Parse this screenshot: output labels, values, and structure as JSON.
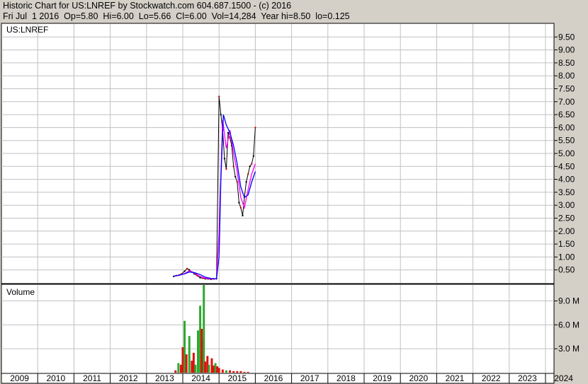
{
  "header": {
    "line1": "Historic Chart for US:LNREF by Stockwatch.com 604.687.1500 - (c) 2016",
    "line2": "Fri Jul  1 2016  Op=5.80  Hi=6.00  Lo=5.66  Cl=6.00  Vol=14,284  Year hi=8.50  lo=0.125"
  },
  "colors": {
    "background": "#d4d0c8",
    "panel": "#ffffff",
    "grid": "#c0c0c0",
    "up_bar": "#000000",
    "down_bar": "#cc0000",
    "ma_short": "#ff00ff",
    "ma_long": "#0000ff",
    "vol_up": "#2fa82f",
    "vol_down": "#e01010"
  },
  "chart_data": [
    {
      "type": "line",
      "title": "US:LNREF",
      "ylim": [
        0,
        10
      ],
      "yticks": [
        "0.50",
        "1.00",
        "1.50",
        "2.00",
        "2.50",
        "3.00",
        "3.50",
        "4.00",
        "4.50",
        "5.00",
        "5.50",
        "6.00",
        "6.50",
        "7.00",
        "7.50",
        "8.00",
        "8.50",
        "9.00",
        "9.50"
      ],
      "x_tick_labels": [
        "2009",
        "2010",
        "2011",
        "2012",
        "2013",
        "2014",
        "2015",
        "2016",
        "2017",
        "2018",
        "2019",
        "2020",
        "2021",
        "2022",
        "2023",
        "2024"
      ],
      "series": [
        {
          "name": "",
          "x": [
            2013.75,
            2013.82,
            2013.9,
            2013.97,
            2014.05,
            2014.12,
            2014.18,
            2014.25,
            2014.32,
            2014.4,
            2014.48,
            2014.55,
            2014.62,
            2014.7,
            2014.78,
            2014.86,
            2014.93,
            2015.0,
            2015.05,
            2015.1,
            2015.15,
            2015.2,
            2015.25,
            2015.3,
            2015.35,
            2015.4,
            2015.45,
            2015.5,
            2015.55,
            2015.6,
            2015.65,
            2015.7,
            2015.75,
            2015.8,
            2015.85,
            2015.9,
            2015.95,
            2016.0
          ],
          "y": [
            0.25,
            0.28,
            0.3,
            0.35,
            0.45,
            0.55,
            0.5,
            0.42,
            0.35,
            0.28,
            0.2,
            0.18,
            0.16,
            0.15,
            0.14,
            0.15,
            0.16,
            7.2,
            6.5,
            5.9,
            4.8,
            4.4,
            5.8,
            5.6,
            5.3,
            4.5,
            4.1,
            3.9,
            3.1,
            2.9,
            2.6,
            3.3,
            3.9,
            4.2,
            4.5,
            4.6,
            4.9,
            6.0
          ]
        },
        {
          "name": "",
          "x": [
            2013.75,
            2013.9,
            2014.05,
            2014.18,
            2014.32,
            2014.48,
            2014.62,
            2014.78,
            2014.93,
            2015.0,
            2015.1,
            2015.2,
            2015.3,
            2015.4,
            2015.5,
            2015.6,
            2015.7,
            2015.8,
            2015.9,
            2016.0
          ],
          "y": [
            0.26,
            0.29,
            0.36,
            0.47,
            0.38,
            0.25,
            0.18,
            0.15,
            0.16,
            2.0,
            6.3,
            5.2,
            5.9,
            5.0,
            4.3,
            3.3,
            2.9,
            3.6,
            4.2,
            4.6
          ]
        },
        {
          "name": "",
          "x": [
            2013.75,
            2013.9,
            2014.05,
            2014.18,
            2014.32,
            2014.48,
            2014.62,
            2014.78,
            2014.93,
            2015.0,
            2015.05,
            2015.12,
            2015.2,
            2015.3,
            2015.4,
            2015.5,
            2015.6,
            2015.7,
            2015.8,
            2015.9,
            2016.0
          ],
          "y": [
            0.26,
            0.3,
            0.35,
            0.42,
            0.4,
            0.32,
            0.22,
            0.17,
            0.16,
            1.0,
            4.0,
            6.5,
            6.1,
            5.8,
            5.3,
            4.6,
            3.7,
            3.3,
            3.4,
            3.9,
            4.3
          ]
        }
      ]
    },
    {
      "type": "bar",
      "title": "Volume",
      "ylim": [
        0,
        11
      ],
      "yticks": [
        "3.0 M",
        "6.0 M",
        "9.0 M"
      ],
      "series": [
        {
          "name": "",
          "x": [
            2013.8,
            2013.88,
            2013.95,
            2014.0,
            2014.05,
            2014.1,
            2014.18,
            2014.25,
            2014.3,
            2014.35,
            2014.42,
            2014.48,
            2014.52,
            2014.55,
            2014.58,
            2014.62,
            2014.68,
            2014.72,
            2014.8,
            2014.85,
            2014.9,
            2014.95,
            2015.0,
            2015.1,
            2015.2,
            2015.3,
            2015.4,
            2015.5,
            2015.6,
            2015.7,
            2015.8
          ],
          "values": [
            0.3,
            1.2,
            1.0,
            3.2,
            6.5,
            2.3,
            4.6,
            1.5,
            2.5,
            1.0,
            5.3,
            8.4,
            5.5,
            4.2,
            11.0,
            1.4,
            2.1,
            1.0,
            1.8,
            0.9,
            1.2,
            0.8,
            0.6,
            0.4,
            0.3,
            0.3,
            0.2,
            0.2,
            0.2,
            0.1,
            0.1
          ],
          "colors": [
            "down",
            "up",
            "down",
            "down",
            "up",
            "down",
            "up",
            "down",
            "down",
            "up",
            "up",
            "up",
            "down",
            "down",
            "up",
            "down",
            "down",
            "up",
            "down",
            "down",
            "up",
            "down",
            "down",
            "down",
            "up",
            "down",
            "down",
            "down",
            "down",
            "down",
            "down"
          ]
        }
      ]
    }
  ]
}
